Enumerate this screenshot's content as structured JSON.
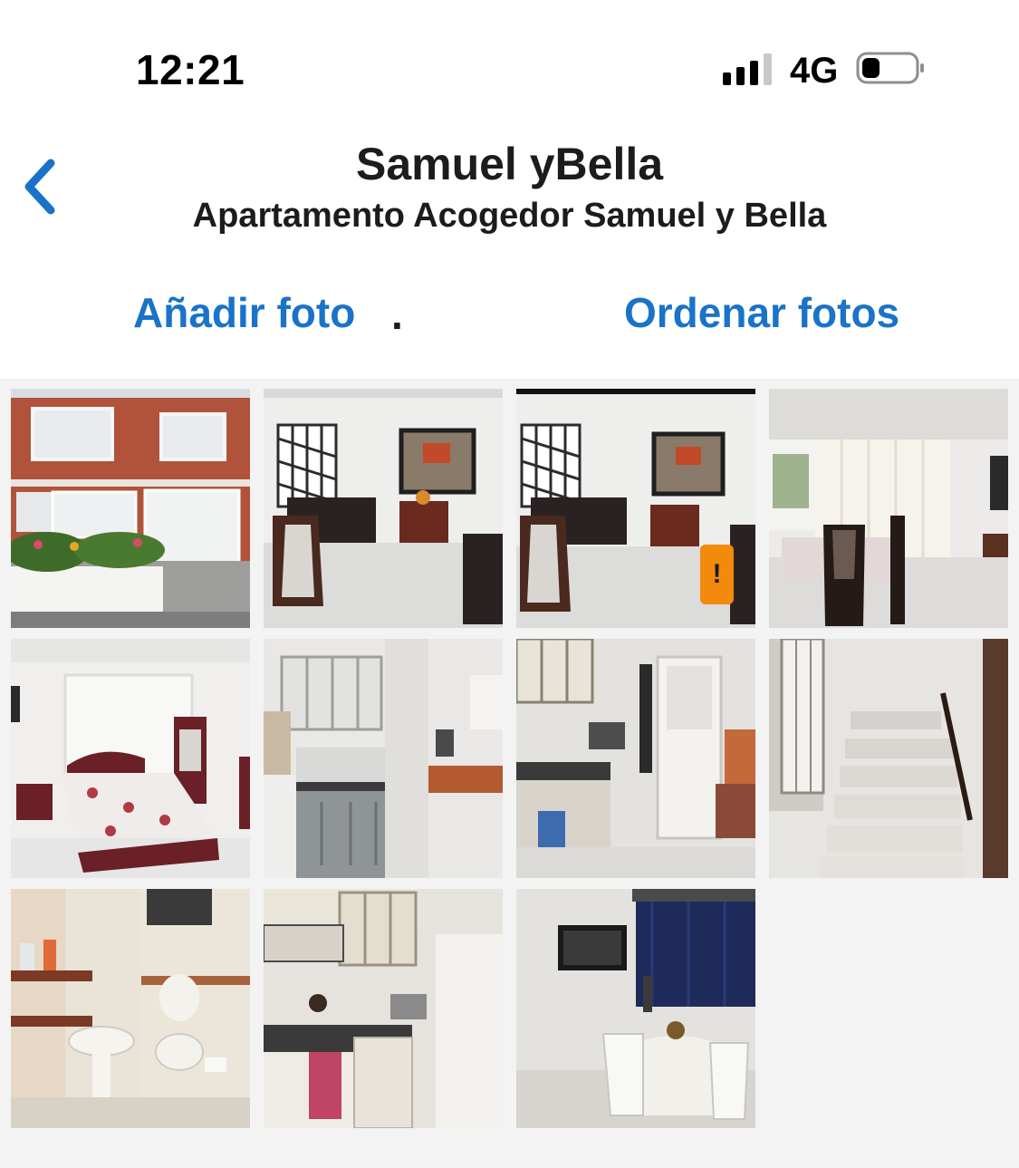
{
  "status_bar": {
    "time": "12:21",
    "network": "4G",
    "icons": [
      "signal-icon",
      "battery-icon"
    ]
  },
  "header": {
    "back_icon": "chevron-left-icon",
    "title": "Samuel yBella",
    "subtitle": "Apartamento Acogedor Samuel y Bella"
  },
  "actions": {
    "add_photo": "Añadir foto",
    "separator": ".",
    "sort_photos": "Ordenar fotos"
  },
  "photos": [
    {
      "subject": "building-exterior"
    },
    {
      "subject": "living-room"
    },
    {
      "subject": "living-room",
      "warning_badge": "!"
    },
    {
      "subject": "dining-room"
    },
    {
      "subject": "bedroom"
    },
    {
      "subject": "kitchen"
    },
    {
      "subject": "kitchen-laundry"
    },
    {
      "subject": "staircase"
    },
    {
      "subject": "bathroom"
    },
    {
      "subject": "kitchen-stove"
    },
    {
      "subject": "dining-corner-tv"
    }
  ],
  "colors": {
    "accent": "#1a73c8",
    "text": "#1c1c1e",
    "grid_background": "#f3f3f3",
    "warning": "#f28a0c"
  }
}
